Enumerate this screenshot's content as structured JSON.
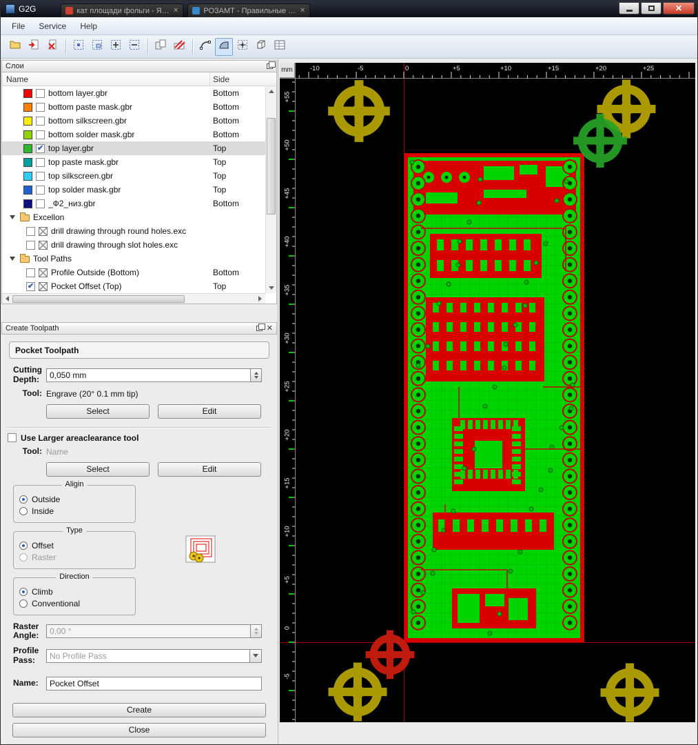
{
  "window": {
    "title": "G2G",
    "tabs": [
      {
        "label": "кат площади фольги - Янд..."
      },
      {
        "label": "РОЗАМТ - Правильные с..."
      }
    ],
    "glyphs": {
      "close": "✕",
      "tab_close": "✕"
    }
  },
  "menu": {
    "items": [
      "File",
      "Service",
      "Help"
    ]
  },
  "toolbar": {
    "icons": [
      "open-project",
      "import-gerber",
      "remove-gerber",
      "zoom-extents",
      "zoom-window",
      "zoom-in",
      "zoom-out",
      "mirror-board",
      "clear-layer",
      "arc-tool",
      "interpolation-tool",
      "origin-tool",
      "view-3d",
      "gcode-table"
    ]
  },
  "layers_panel": {
    "title": "Слои",
    "columns": [
      "Name",
      "Side"
    ],
    "rows": [
      {
        "name": "bottom layer.gbr",
        "side": "Bottom",
        "color": "#f40000",
        "checked": false
      },
      {
        "name": "bottom paste mask.gbr",
        "side": "Bottom",
        "color": "#ff8000",
        "checked": false
      },
      {
        "name": "bottom silkscreen.gbr",
        "side": "Bottom",
        "color": "#ffee00",
        "checked": false
      },
      {
        "name": "bottom solder mask.gbr",
        "side": "Bottom",
        "color": "#8fd400",
        "checked": false
      },
      {
        "name": "top layer.gbr",
        "side": "Top",
        "color": "#2eb82e",
        "checked": true
      },
      {
        "name": "top paste mask.gbr",
        "side": "Top",
        "color": "#00a0a0",
        "checked": false
      },
      {
        "name": "top silkscreen.gbr",
        "side": "Top",
        "color": "#33ccff",
        "checked": false
      },
      {
        "name": "top solder mask.gbr",
        "side": "Top",
        "color": "#2060d0",
        "checked": false
      },
      {
        "name": "_Ф2_низ.gbr",
        "side": "Bottom",
        "color": "#101080",
        "checked": false
      },
      {
        "name": "Excellon"
      },
      {
        "name": "drill drawing through round holes.exc",
        "checked": false
      },
      {
        "name": "drill drawing through slot holes.exc",
        "checked": false
      },
      {
        "name": "Tool Paths"
      },
      {
        "name": "Profile Outside (Bottom)",
        "side": "Bottom",
        "checked": false
      },
      {
        "name": "Pocket Offset (Top)",
        "side": "Top",
        "checked": true
      }
    ]
  },
  "toolpath_panel": {
    "title": "Create Toolpath",
    "header": "Pocket Toolpath",
    "cutting_depth_label": "Cutting Depth:",
    "cutting_depth_value": "0,050 mm",
    "tool_label": "Tool:",
    "tool_value": "Engrave (20° 0.1 mm tip)",
    "select_label": "Select",
    "edit_label": "Edit",
    "use_larger_label": "Use Larger areaclearance tool",
    "tool2_label": "Tool:",
    "tool2_value": "Name",
    "align_group": {
      "title": "Aligin",
      "options": [
        "Outside",
        "Inside"
      ],
      "selected": "Outside"
    },
    "type_group": {
      "title": "Type",
      "options": [
        "Offset",
        "Raster"
      ],
      "selected": "Offset"
    },
    "direction_group": {
      "title": "Direction",
      "options": [
        "Climb",
        "Conventional"
      ],
      "selected": "Climb"
    },
    "raster_angle_label": "Raster Angle:",
    "raster_angle_value": "0,00 °",
    "profile_pass_label": "Profile Pass:",
    "profile_pass_value": "No Profile Pass",
    "name_label": "Name:",
    "name_value": "Pocket Offset",
    "create_label": "Create",
    "close_label": "Close"
  },
  "canvas": {
    "unit": "mm",
    "hruler": [
      "-10",
      "-5",
      "0",
      "+5",
      "+10",
      "+15",
      "+20",
      "+25"
    ],
    "vruler": [
      "+55",
      "+50",
      "+45",
      "+40",
      "+35",
      "+30",
      "+25",
      "+20",
      "+15",
      "+10",
      "+5",
      "0",
      "-5"
    ],
    "colors": {
      "board": "#d80000",
      "copper": "#00d400",
      "grid": "#00b000",
      "axis": "#a00000",
      "fiducial_yellow": "#b9a700",
      "fiducial_green": "#27a327",
      "fiducial_red": "#cf1d10"
    }
  }
}
